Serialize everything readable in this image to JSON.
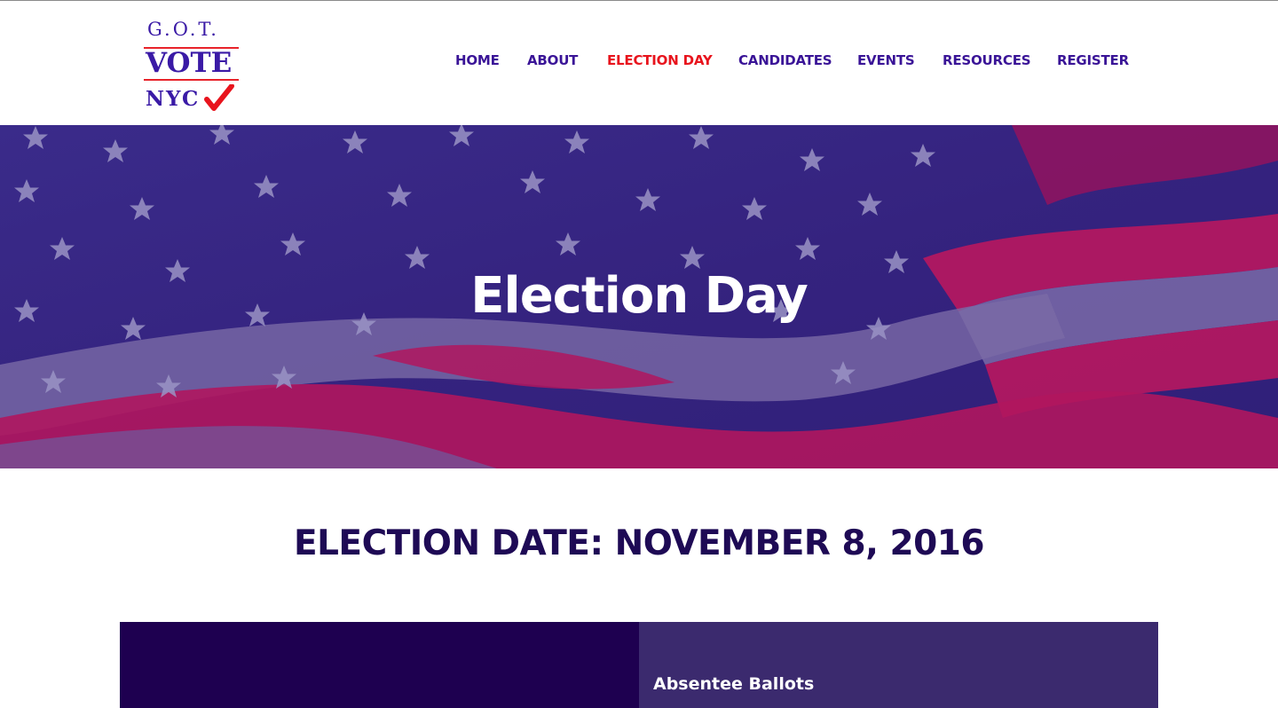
{
  "logo": {
    "line1": "G.O.T.",
    "line2": "VOTE",
    "line3": "NYC",
    "check_icon": "red-checkmark-icon"
  },
  "nav": {
    "items": [
      {
        "label": "HOME",
        "active": false
      },
      {
        "label": "ABOUT",
        "active": false
      },
      {
        "label": "ELECTION DAY",
        "active": true
      },
      {
        "label": "CANDIDATES",
        "active": false
      },
      {
        "label": "EVENTS",
        "active": false
      },
      {
        "label": "RESOURCES",
        "active": false
      },
      {
        "label": "REGISTER",
        "active": false
      }
    ]
  },
  "hero": {
    "title": "Election Day",
    "background": "american-flag-image"
  },
  "main": {
    "election_date": "ELECTION DATE: NOVEMBER 8, 2016",
    "panels": [
      {
        "title": ""
      },
      {
        "title": "Absentee Ballots"
      }
    ]
  },
  "colors": {
    "brand_purple": "#3a1497",
    "active_red": "#e8141d",
    "heading_dark": "#1e0a55",
    "panel_dark": "#1e0050",
    "panel_mid": "#3b2a6e"
  }
}
